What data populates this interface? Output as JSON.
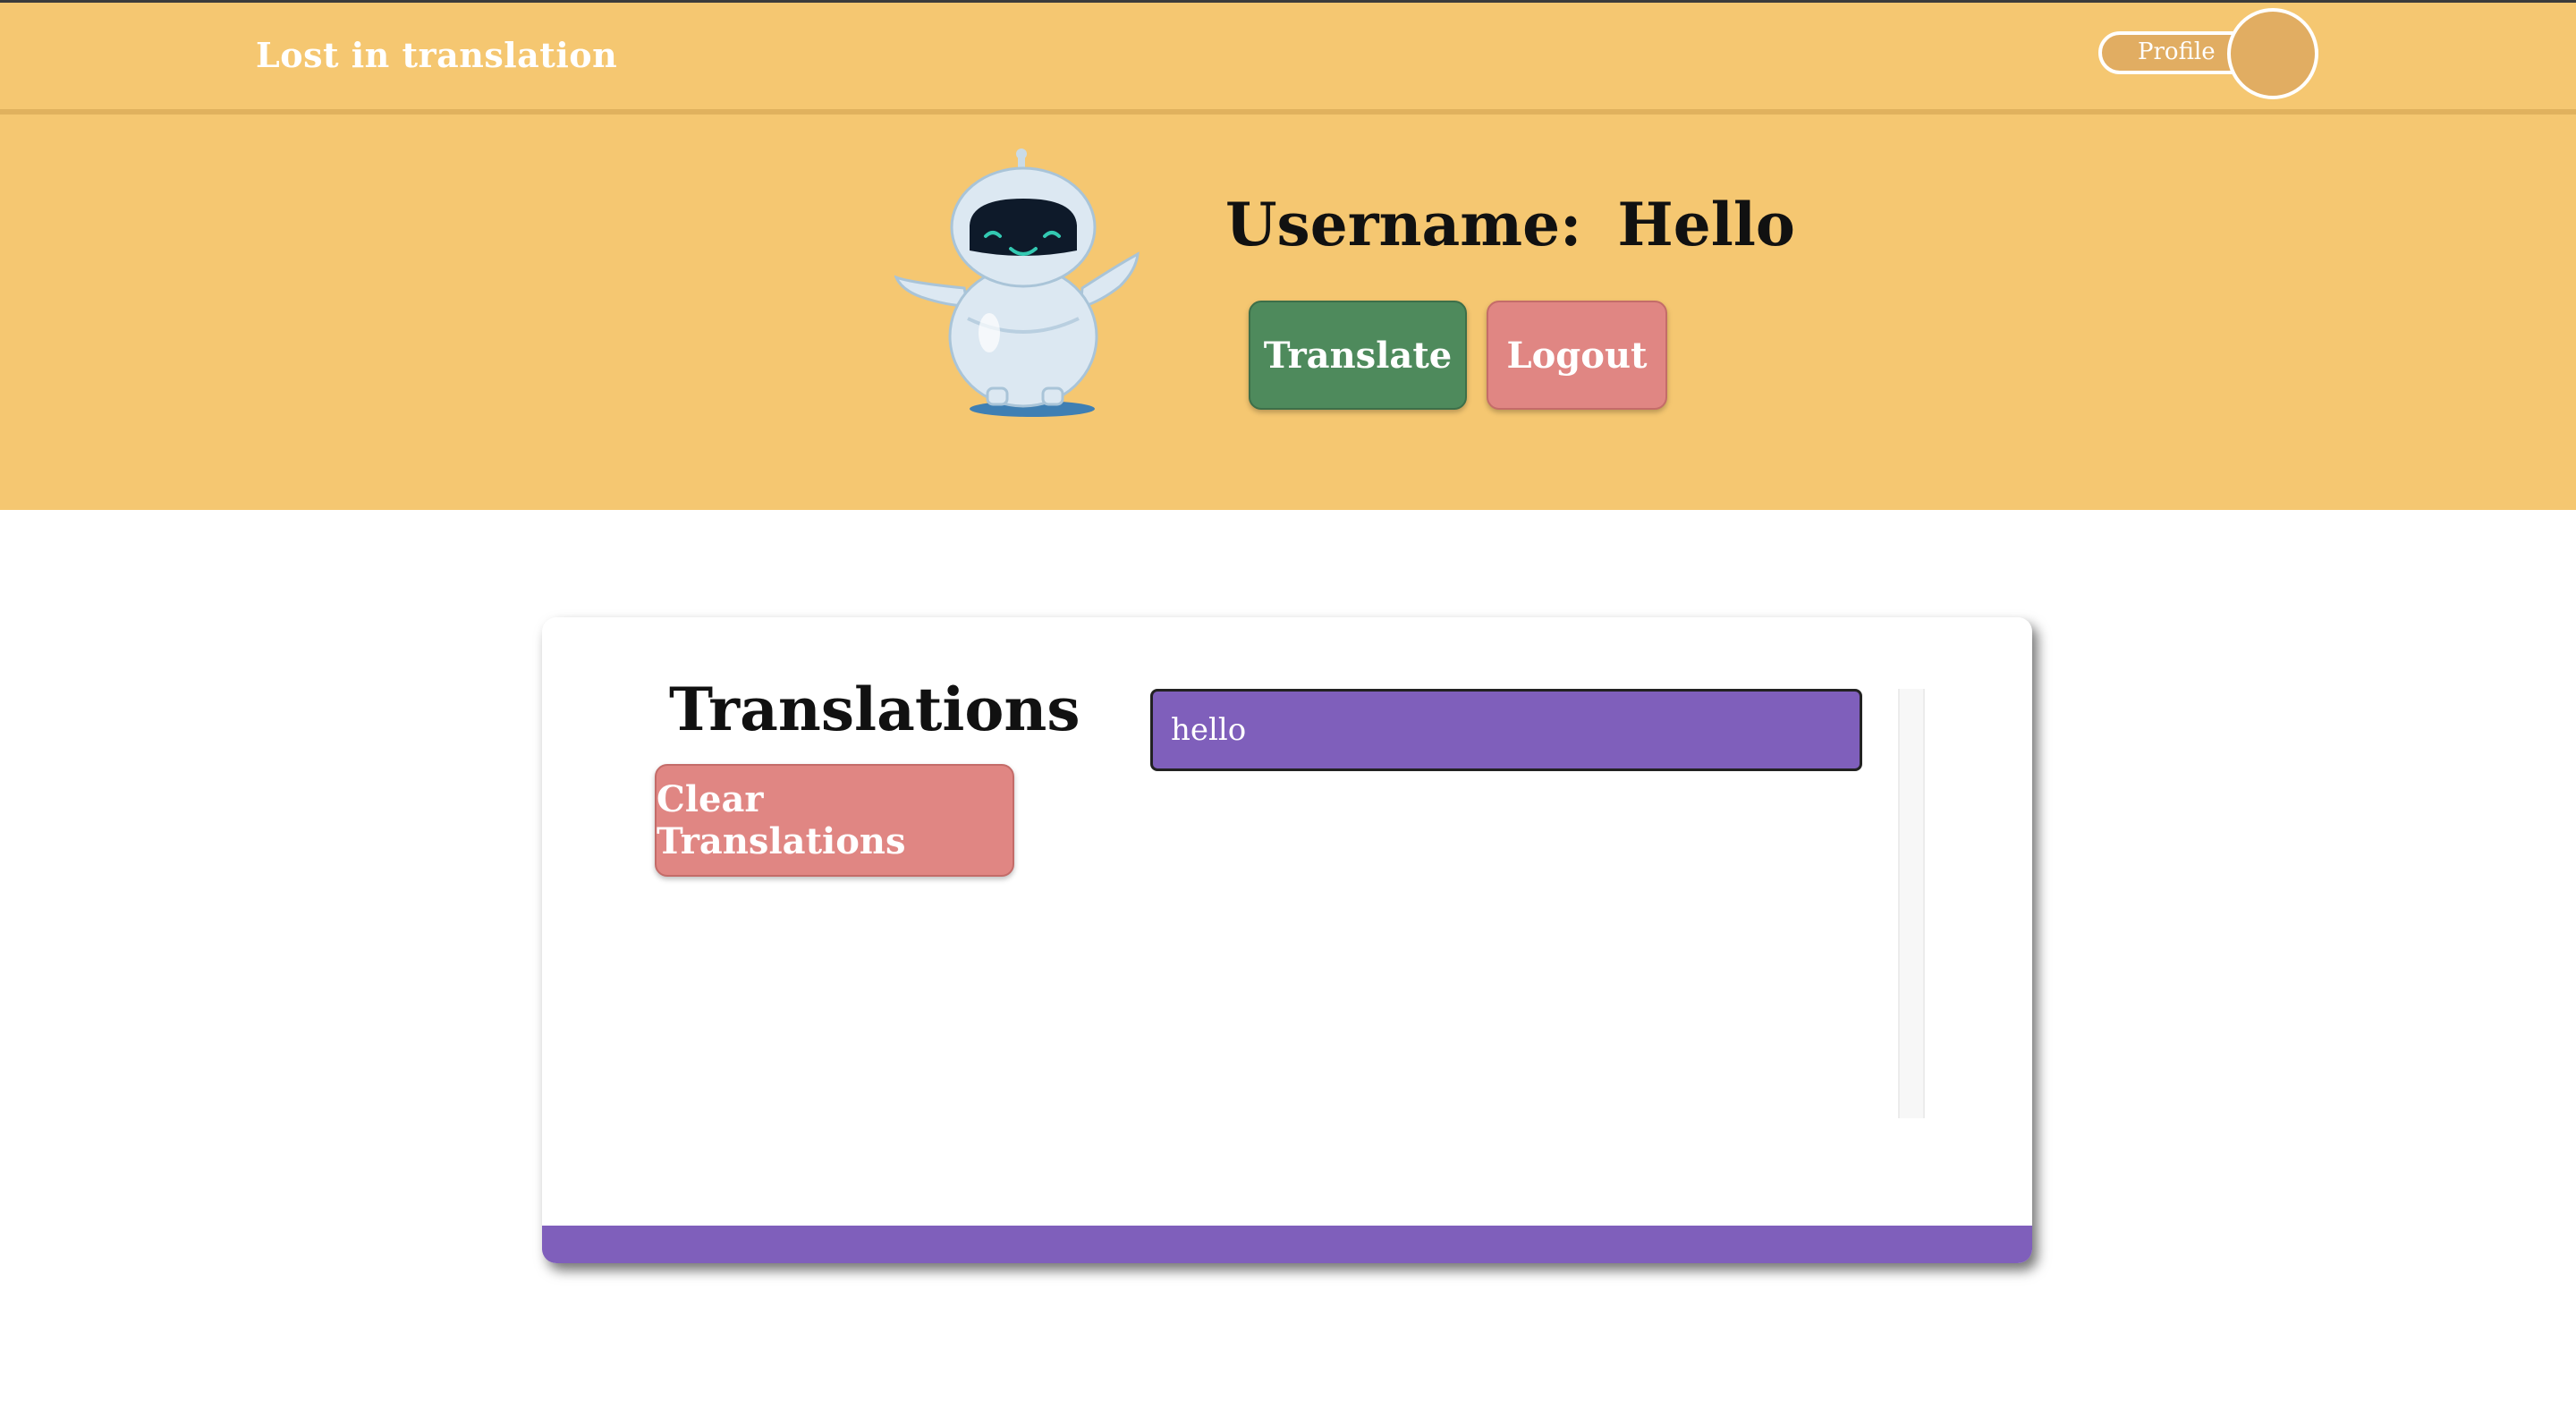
{
  "navbar": {
    "brand": "Lost in translation",
    "profile_label": "Profile"
  },
  "hero": {
    "username_label": "Username:",
    "username_value": "Hello",
    "translate_button": "Translate",
    "logout_button": "Logout"
  },
  "translations": {
    "title": "Translations",
    "clear_button": "Clear Translations",
    "items": [
      "hello"
    ]
  },
  "colors": {
    "header_bg": "#f5c771",
    "translate_green": "#4e8a5c",
    "logout_red": "#e08683",
    "accent_purple": "#7f5fbb"
  }
}
